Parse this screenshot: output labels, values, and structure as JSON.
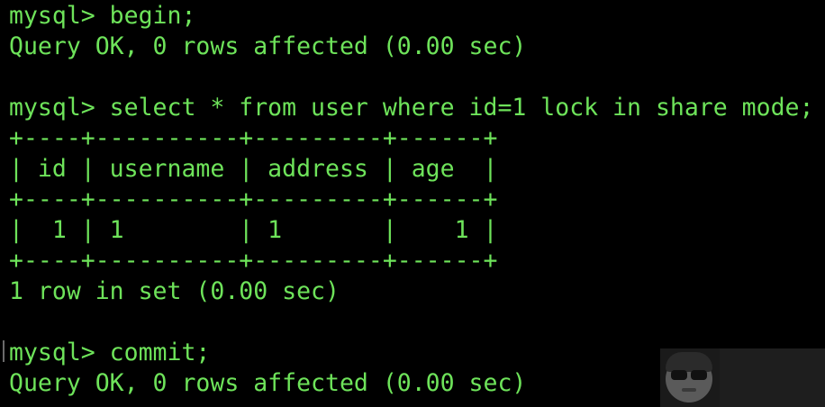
{
  "terminal": {
    "lines": [
      "mysql> begin;",
      "Query OK, 0 rows affected (0.00 sec)",
      "",
      "mysql> select * from user where id=1 lock in share mode;",
      "+----+----------+---------+------+",
      "| id | username | address | age  |",
      "+----+----------+---------+------+",
      "|  1 | 1        | 1       |    1 |",
      "+----+----------+---------+------+",
      "1 row in set (0.00 sec)",
      "",
      "mysql> commit;",
      "Query OK, 0 rows affected (0.00 sec)"
    ]
  },
  "colors": {
    "background": "#000000",
    "text": "#6ee35a"
  },
  "watermark": {
    "icon": "avatar-icon"
  }
}
